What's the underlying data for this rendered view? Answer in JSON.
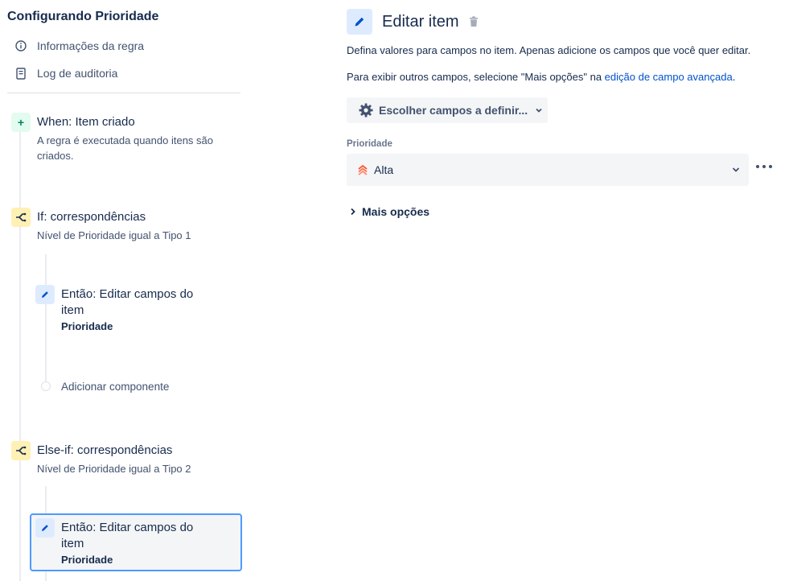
{
  "left": {
    "title": "Configurando Prioridade",
    "meta": [
      {
        "label": "Informações da regra",
        "icon": "info-icon"
      },
      {
        "label": "Log de auditoria",
        "icon": "document-icon"
      }
    ],
    "components": {
      "trigger": {
        "title": "When: Item criado",
        "sub_line1": "A regra é executada quando itens são",
        "sub_line2": "criados.",
        "badge": "+"
      },
      "if1": {
        "title": "If: correspondências",
        "sub": "Nível de Prioridade igual a Tipo 1"
      },
      "action1": {
        "title_line1": "Então: Editar campos do",
        "title_line2": "item",
        "bold": "Prioridade"
      },
      "add": {
        "label": "Adicionar componente"
      },
      "elseif": {
        "title": "Else-if: correspondências",
        "sub": "Nível de Prioridade igual a Tipo 2"
      },
      "action2": {
        "title_line1": "Então: Editar campos do",
        "title_line2": "item",
        "bold": "Prioridade"
      }
    }
  },
  "right": {
    "title": "Editar item",
    "desc1": "Defina valores para campos no item. Apenas adicione os campos que você quer editar.",
    "desc2_prefix": "Para exibir outros campos, selecione \"Mais opções\" na ",
    "desc2_link": "edição de campo avançada",
    "desc2_suffix": ".",
    "choose_button": "Escolher campos a definir...",
    "field_label": "Prioridade",
    "field_value": "Alta",
    "more_options": "Mais opções"
  },
  "colors": {
    "accent": "#0052cc",
    "selected_border": "#4c9aff",
    "trigger_badge": "#e3fcef",
    "condition_badge": "#fff0b3",
    "action_badge": "#deebff",
    "priority_high": "#ff5630"
  }
}
